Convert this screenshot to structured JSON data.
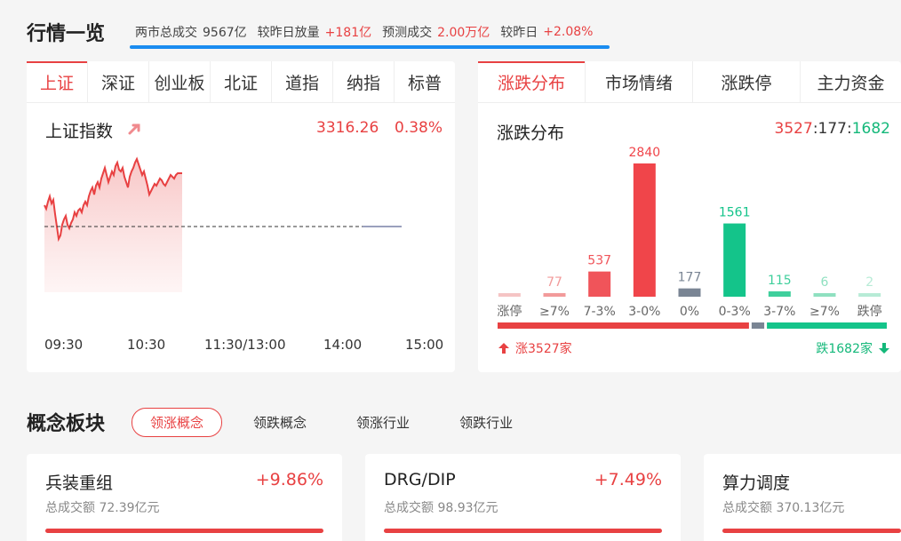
{
  "header": {
    "title": "行情一览",
    "summary": {
      "turnover_label": "两市总成交",
      "turnover_value": "9567亿",
      "vs_label": "较昨日放量",
      "vs_value": "+181亿",
      "forecast_label": "预测成交",
      "forecast_value": "2.00万亿",
      "forecast_vs_label": "较昨日",
      "forecast_vs_value": "+2.08%"
    }
  },
  "index_panel": {
    "tabs": [
      "上证",
      "深证",
      "创业板",
      "北证",
      "道指",
      "纳指",
      "标普"
    ],
    "active_tab": 0,
    "index_name": "上证指数",
    "index_value": "3316.26",
    "index_change_pct": "0.38%",
    "time_labels": [
      "09:30",
      "10:30",
      "11:30/13:00",
      "14:00",
      "15:00"
    ],
    "intraday_progress": 0.37,
    "colors": {
      "up": "#e84142",
      "down": "#14b87a"
    }
  },
  "distribution_panel": {
    "tabs": [
      "涨跌分布",
      "市场情绪",
      "涨跌停",
      "主力资金"
    ],
    "active_tab": 0,
    "title": "涨跌分布",
    "ratio": {
      "up": "3527",
      "flat": "177",
      "down": "1682",
      "sep": ":"
    },
    "up_text": "涨3527家",
    "down_text": "跌1682家"
  },
  "chart_data": {
    "type": "bar",
    "categories": [
      "涨停",
      "≥7%",
      "7-3%",
      "3-0%",
      "0%",
      "0-3%",
      "3-7%",
      "≥7%",
      "跌停"
    ],
    "values": [
      null,
      77,
      537,
      2840,
      177,
      1561,
      115,
      6,
      2
    ],
    "value_labels": [
      "",
      "77",
      "537",
      "2840",
      "177",
      "1561",
      "115",
      "6",
      "2"
    ],
    "colors": [
      "#f5c4c4",
      "#f29a9a",
      "#f0545a",
      "#f0454a",
      "#7a8594",
      "#14c48a",
      "#3fcf9c",
      "#8fe0c0",
      "#b7ebd6"
    ],
    "split": {
      "up": 3527,
      "flat": 177,
      "down": 1682
    }
  },
  "concept_section": {
    "title": "概念板块",
    "tabs": [
      "领涨概念",
      "领跌概念",
      "领涨行业",
      "领跌行业"
    ],
    "active_tab": 0,
    "cards": [
      {
        "name": "兵装重组",
        "pct": "+9.86%",
        "turnover": "总成交额 72.39亿元"
      },
      {
        "name": "DRG/DIP",
        "pct": "+7.49%",
        "turnover": "总成交额 98.93亿元"
      },
      {
        "name": "算力调度",
        "pct": "",
        "turnover": "总成交额 370.13亿元"
      }
    ]
  }
}
